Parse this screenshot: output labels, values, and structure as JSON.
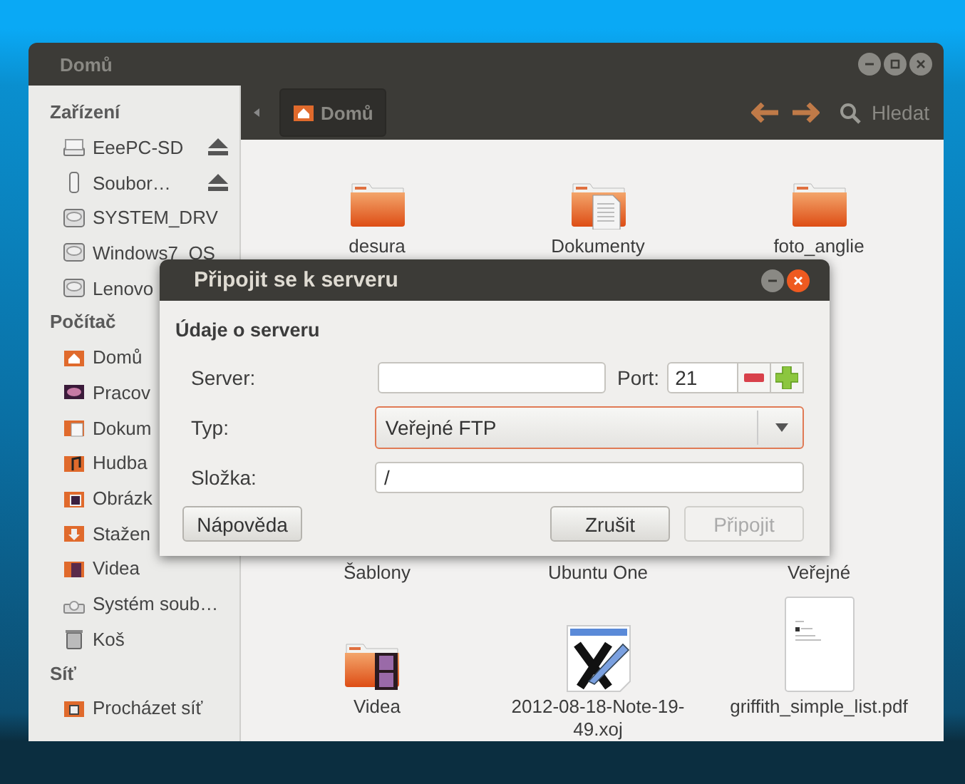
{
  "window": {
    "title": "Domů"
  },
  "sidebar": {
    "sections": [
      {
        "heading": "Zařízení",
        "items": [
          {
            "label": "EeePC-SD",
            "kind": "drive",
            "eject": true
          },
          {
            "label": "Soubor…",
            "kind": "usb",
            "eject": true
          },
          {
            "label": "SYSTEM_DRV",
            "kind": "hdd",
            "eject": false
          },
          {
            "label": "Windows7_OS",
            "kind": "hdd",
            "eject": false
          },
          {
            "label": "Lenovo",
            "kind": "hdd",
            "eject": false
          }
        ]
      },
      {
        "heading": "Počítač",
        "items": [
          {
            "label": "Domů",
            "kind": "home",
            "eject": false
          },
          {
            "label": "Pracov",
            "kind": "desktop",
            "eject": false
          },
          {
            "label": "Dokum",
            "kind": "documents",
            "eject": false
          },
          {
            "label": "Hudba",
            "kind": "music",
            "eject": false
          },
          {
            "label": "Obrázk",
            "kind": "pictures",
            "eject": false
          },
          {
            "label": "Stažen",
            "kind": "downloads",
            "eject": false
          },
          {
            "label": "Videa",
            "kind": "videos",
            "eject": false
          },
          {
            "label": "Systém soub…",
            "kind": "filesystem",
            "eject": false
          },
          {
            "label": "Koš",
            "kind": "trash",
            "eject": false
          }
        ]
      },
      {
        "heading": "Síť",
        "items": [
          {
            "label": "Procházet síť",
            "kind": "network",
            "eject": false
          }
        ]
      }
    ]
  },
  "toolbar": {
    "location": "Domů",
    "search_label": "Hledat"
  },
  "files": {
    "rows": [
      {
        "items": [
          {
            "name": "desura",
            "kind": "folder"
          },
          {
            "name": "Dokumenty",
            "kind": "documents"
          },
          {
            "name": "foto_anglie",
            "kind": "folder"
          }
        ]
      },
      {
        "items": [
          {
            "name": "Šablony",
            "kind": "covered"
          },
          {
            "name": "Ubuntu One",
            "kind": "covered"
          },
          {
            "name": "Veřejné",
            "kind": "covered"
          }
        ]
      },
      {
        "items": [
          {
            "name": "Videa",
            "kind": "videos"
          },
          {
            "name": "2012-08-18-Note-19-49.xoj",
            "kind": "xoj"
          },
          {
            "name": "griffith_simple_list.pdf",
            "kind": "pdf"
          }
        ]
      }
    ]
  },
  "dialog": {
    "title": "Připojit se k serveru",
    "section": "Údaje o serveru",
    "server": {
      "label": "Server:"
    },
    "port": {
      "label": "Port:",
      "value": "21"
    },
    "type": {
      "label": "Typ:",
      "value": "Veřejné FTP"
    },
    "folder": {
      "label": "Složka:",
      "value": "/"
    },
    "buttons": [
      {
        "label": "Nápověda",
        "kind": "help",
        "disabled": false
      },
      {
        "label": "Zrušit",
        "kind": "cancel",
        "disabled": false
      },
      {
        "label": "Připojit",
        "kind": "connect",
        "disabled": true
      }
    ]
  }
}
